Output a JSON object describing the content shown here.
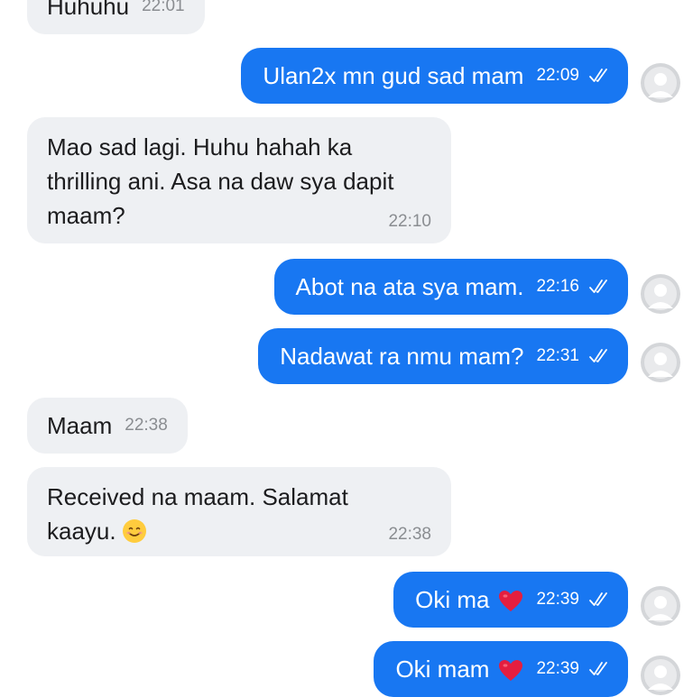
{
  "colors": {
    "outgoing_bubble": "#1877f2",
    "incoming_bubble": "#eef0f3",
    "incoming_time": "#8a8d91",
    "heart": "#e41e3f",
    "smile_face": "#ffcc3e"
  },
  "messages": [
    {
      "direction": "incoming",
      "text": "Huhuhu",
      "time": "22:01"
    },
    {
      "direction": "outgoing",
      "text": "Ulan2x mn gud sad mam",
      "time": "22:09",
      "status_icon": "double-check-icon",
      "avatar_icon": "default-avatar-icon"
    },
    {
      "direction": "incoming",
      "text": "Mao sad lagi. Huhu hahah ka thrilling ani. Asa na daw sya dapit maam?",
      "time": "22:10"
    },
    {
      "direction": "outgoing",
      "text": "Abot na ata sya mam.",
      "time": "22:16",
      "status_icon": "double-check-icon",
      "avatar_icon": "default-avatar-icon"
    },
    {
      "direction": "outgoing",
      "text": "Nadawat ra nmu mam?",
      "time": "22:31",
      "status_icon": "double-check-icon",
      "avatar_icon": "default-avatar-icon"
    },
    {
      "direction": "incoming",
      "text": "Maam",
      "time": "22:38"
    },
    {
      "direction": "incoming",
      "text": "Received na maam. Salamat kaayu.",
      "emoji": "smiling-face-icon",
      "time": "22:38"
    },
    {
      "direction": "outgoing",
      "text": "Oki ma",
      "emoji": "red-heart-icon",
      "time": "22:39",
      "status_icon": "double-check-icon",
      "avatar_icon": "default-avatar-icon"
    },
    {
      "direction": "outgoing",
      "text": "Oki mam",
      "emoji": "red-heart-icon",
      "time": "22:39",
      "status_icon": "double-check-icon",
      "avatar_icon": "default-avatar-icon"
    }
  ]
}
